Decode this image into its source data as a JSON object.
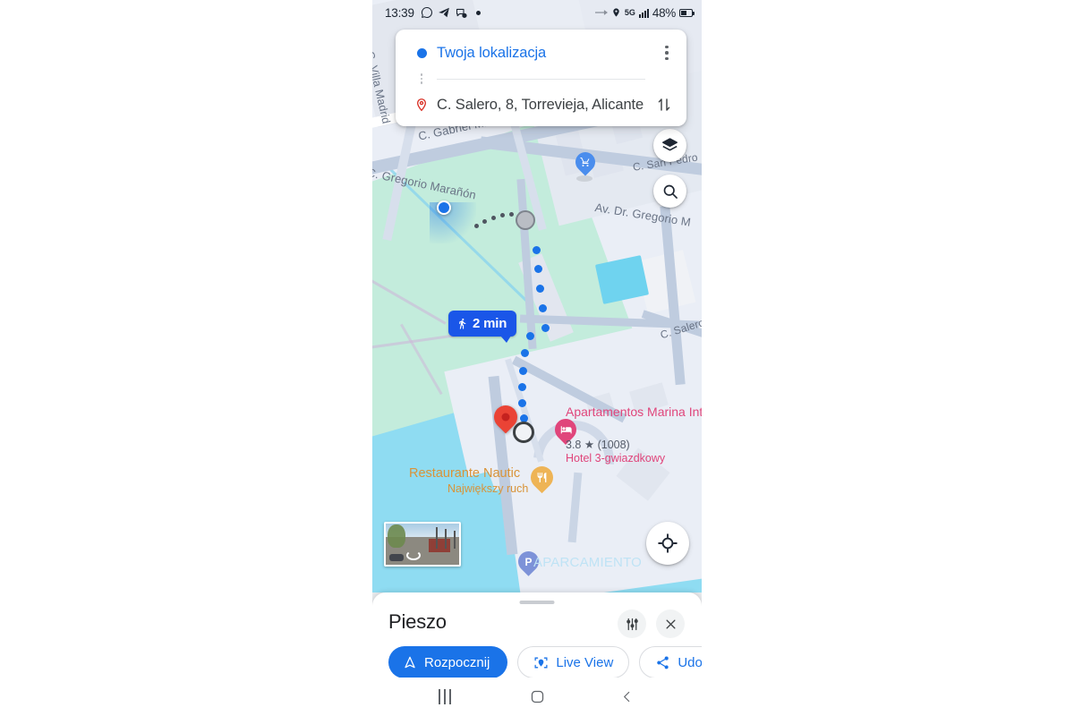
{
  "status_bar": {
    "time": "13:39",
    "icons": [
      "whatsapp-icon",
      "telegram-icon",
      "messenger-icon",
      "dot-indicator"
    ],
    "location_icon": "location-pin-icon",
    "network": "5G",
    "signal_icon": "signal-bars-icon",
    "battery_percent": "48%"
  },
  "search_card": {
    "origin_label": "Twoja lokalizacja",
    "destination_label": "C. Salero, 8, Torrevieja, Alicante",
    "origin_icon": "blue-dot-icon",
    "destination_icon": "red-place-pin-icon",
    "more_options_icon": "kebab-menu-icon",
    "swap_icon": "swap-vertical-icon"
  },
  "map": {
    "controls": {
      "layers_icon": "layers-icon",
      "search_icon": "search-icon",
      "recenter_icon": "my-location-icon"
    },
    "eta_badge": {
      "icon": "walking-person-icon",
      "text": "2 min"
    },
    "street_labels": [
      {
        "text": "C. Villa Madrid"
      },
      {
        "text": "C. Gabriel Miro"
      },
      {
        "text": "C. Gregorio Marañón"
      },
      {
        "text": "Av. Dr. Gregorio M"
      },
      {
        "text": "C. San Pedro"
      },
      {
        "text": "C. Salero"
      }
    ],
    "pois": [
      {
        "name": "Apartamentos Marina Internacional",
        "rating": "3.8",
        "reviews": "(1008)",
        "category": "Hotel 3-gwiazdkowy",
        "icon": "hotel-bed-icon"
      },
      {
        "name": "Restaurante Nautic",
        "subtitle": "Największy ruch",
        "icon": "restaurant-icon"
      },
      {
        "name": "APARCAMIENTO",
        "icon": "parking-icon"
      },
      {
        "name": "",
        "icon": "shopping-cart-icon"
      }
    ],
    "street_view_thumb": {
      "icon": "street-view-rotate-icon"
    },
    "colors": {
      "route_blue": "#1a73e8",
      "park_green": "#c3ecdc",
      "water_blue": "#8fdcf2",
      "land": "#eaeef6",
      "destination_red": "#ea4335"
    }
  },
  "bottom_sheet": {
    "title": "Pieszo",
    "options_icon": "tune-sliders-icon",
    "close_icon": "close-x-icon",
    "actions": [
      {
        "label": "Rozpocznij",
        "icon": "navigation-arrow-icon",
        "style": "primary"
      },
      {
        "label": "Live View",
        "icon": "live-view-icon",
        "style": "outline"
      },
      {
        "label": "Udostę",
        "icon": "share-icon",
        "style": "outline"
      }
    ]
  },
  "nav_bar": {
    "recents_icon": "recents-bars-icon",
    "home_icon": "home-square-icon",
    "back_icon": "back-chevron-icon"
  }
}
